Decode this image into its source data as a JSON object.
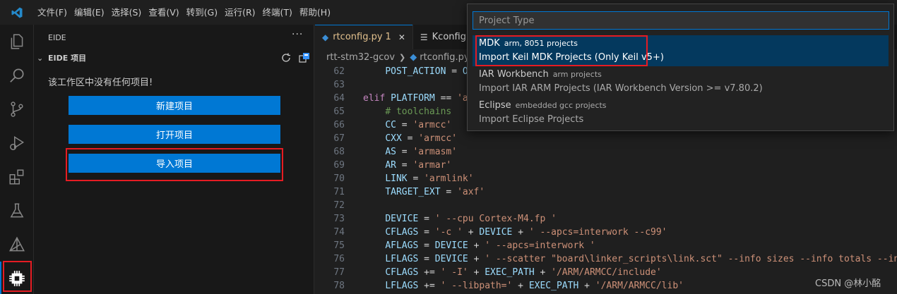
{
  "menu": [
    "文件(F)",
    "编辑(E)",
    "选择(S)",
    "查看(V)",
    "转到(G)",
    "运行(R)",
    "终端(T)",
    "帮助(H)"
  ],
  "activity_bar": [
    "files-icon",
    "search-icon",
    "source-control-icon",
    "run-debug-icon",
    "extensions-icon",
    "testing-icon",
    "cmake-icon",
    "eide-chip-icon"
  ],
  "sidebar": {
    "title": "EIDE",
    "more": "···",
    "section_title": "EIDE 项目",
    "empty_text": "该工作区中没有任何项目!",
    "buttons": [
      "新建项目",
      "打开项目",
      "导入项目"
    ]
  },
  "tabs": [
    {
      "label": "rtconfig.py",
      "badge": "1",
      "active": true
    },
    {
      "label": "Kconfig",
      "active": false
    }
  ],
  "breadcrumb": [
    "rtt-stm32-gcov",
    "rtconfig.py"
  ],
  "code": {
    "line_numbers": [
      "62",
      "63",
      "64",
      "65",
      "66",
      "67",
      "68",
      "69",
      "70",
      "71",
      "72",
      "73",
      "74",
      "75",
      "76",
      "77",
      "78",
      "79"
    ],
    "lines": [
      "    POST_ACTION = O",
      "",
      "elif PLATFORM == 'a",
      "    # toolchains",
      "    CC = 'armcc'",
      "    CXX = 'armcc'",
      "    AS = 'armasm'",
      "    AR = 'armar'",
      "    LINK = 'armlink'",
      "    TARGET_EXT = 'axf'",
      "",
      "    DEVICE = ' --cpu Cortex-M4.fp '",
      "    CFLAGS = '-c ' + DEVICE + ' --apcs=interwork --c99'",
      "    AFLAGS = DEVICE + ' --apcs=interwork '",
      "    LFLAGS = DEVICE + ' --scatter \"board\\linker_scripts\\link.sct\" --info sizes --info totals --info",
      "    CFLAGS += ' -I' + EXEC_PATH + '/ARM/ARMCC/include'",
      "    LFLAGS += ' --libpath=' + EXEC_PATH + '/ARM/ARMCC/lib'",
      ""
    ]
  },
  "quick_pick": {
    "placeholder": "Project Type",
    "items": [
      {
        "label": "MDK",
        "description": "arm, 8051 projects",
        "detail": "Import Keil MDK Projects (Only Keil v5+)",
        "selected": true
      },
      {
        "label": "IAR Workbench",
        "description": "arm projects",
        "detail": "Import IAR ARM Projects (IAR Workbench Version >= v7.80.2)",
        "selected": false
      },
      {
        "label": "Eclipse",
        "description": "embedded gcc projects",
        "detail": "Import Eclipse Projects",
        "selected": false
      }
    ]
  },
  "watermark": "CSDN @林小酩"
}
